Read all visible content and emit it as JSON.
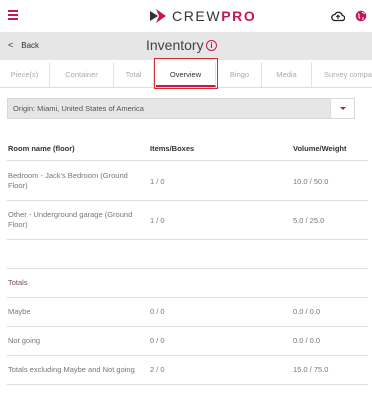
{
  "topbar": {
    "logo_text_a": "CREW",
    "logo_text_b": "PRO",
    "icons": [
      "menu-icon",
      "cloud-upload-icon",
      "globe-icon"
    ]
  },
  "header": {
    "back_label": "Back",
    "title": "Inventory",
    "info_glyph": "i"
  },
  "tabs": [
    {
      "label": "Piece(s)",
      "active": false
    },
    {
      "label": "Container",
      "active": false
    },
    {
      "label": "Total",
      "active": false
    },
    {
      "label": "Overview",
      "active": true
    },
    {
      "label": "Bingo",
      "active": false
    },
    {
      "label": "Media",
      "active": false
    },
    {
      "label": "Survey compa",
      "active": false
    }
  ],
  "origin": {
    "value": "Origin: Miami, United States of America"
  },
  "table": {
    "columns": [
      "Room name (floor)",
      "Items/Boxes",
      "Volume/Weight"
    ],
    "rows": [
      {
        "room": "Bedroom - Jack's Bedroom (Ground Floor)",
        "items": "1 / 0",
        "volume": "10.0 / 50.0"
      },
      {
        "room": "Other - Underground garage (Ground Floor)",
        "items": "1 / 0",
        "volume": "5.0 / 25.0"
      }
    ],
    "totals_label": "Totals",
    "totals": [
      {
        "label": "Maybe",
        "items": "0 / 0",
        "volume": "0.0 / 0.0"
      },
      {
        "label": "Not going",
        "items": "0 / 0",
        "volume": "0.0 / 0.0"
      },
      {
        "label": "Totals excluding Maybe and Not going",
        "items": "2 / 0",
        "volume": "15.0 / 75.0"
      }
    ]
  },
  "colors": {
    "accent": "#c2185b",
    "highlight": "#d32f2f",
    "band": "#e6e6e6"
  }
}
